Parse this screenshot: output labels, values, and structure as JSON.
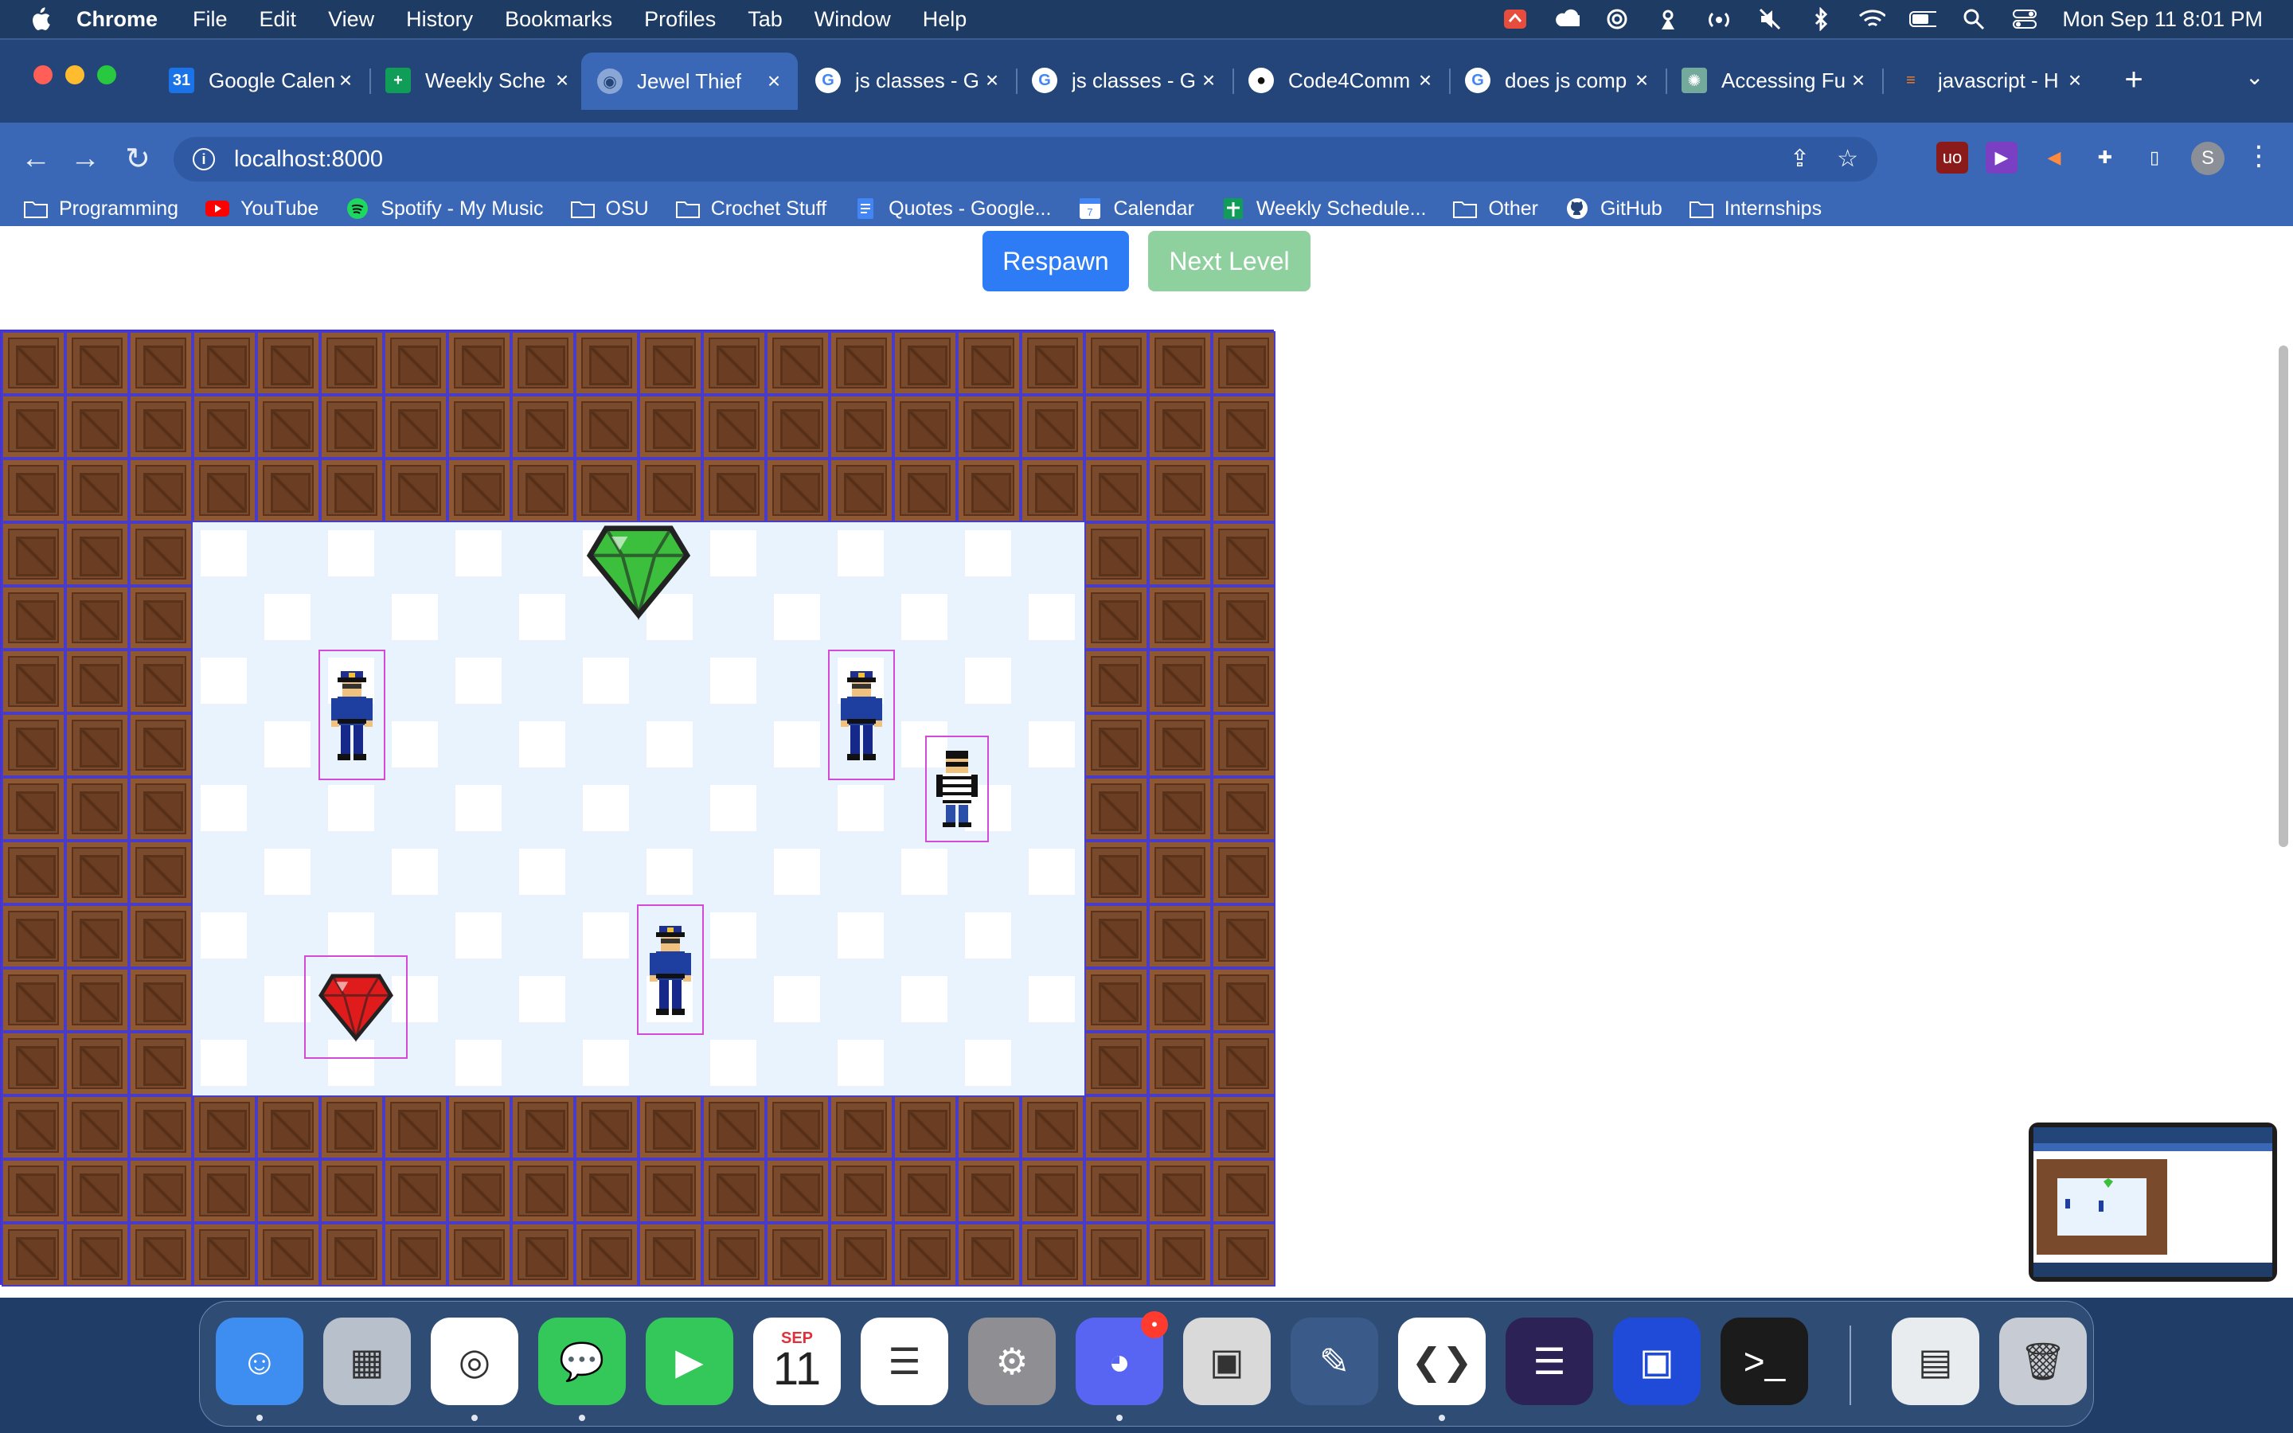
{
  "menubar": {
    "app_name": "Chrome",
    "menus": [
      "File",
      "Edit",
      "View",
      "History",
      "Bookmarks",
      "Profiles",
      "Tab",
      "Window",
      "Help"
    ],
    "status_icons": [
      "app-alert-icon",
      "cloud-icon",
      "moon-icon",
      "airdrop-icon",
      "broadcast-icon",
      "mute-icon",
      "bluetooth-icon",
      "wifi-icon",
      "battery-icon",
      "search-icon",
      "control-center-icon"
    ],
    "clock": "Mon Sep 11  8:01 PM"
  },
  "tabs": [
    {
      "title": "Google Calen",
      "icon": "google-calendar-icon",
      "color": "#1a73e8",
      "glyph": "31"
    },
    {
      "title": "Weekly Sche",
      "icon": "sheets-icon",
      "color": "#0f9d58",
      "glyph": "+"
    },
    {
      "title": "Jewel Thief",
      "icon": "globe-icon",
      "color": "#8aa6d6",
      "glyph": "◉",
      "active": true
    },
    {
      "title": "js classes - G",
      "icon": "google-icon",
      "color": "#ffffff",
      "glyph": "G"
    },
    {
      "title": "js classes - G",
      "icon": "google-icon",
      "color": "#ffffff",
      "glyph": "G"
    },
    {
      "title": "Code4Comm",
      "icon": "github-icon",
      "color": "#ffffff",
      "glyph": "●"
    },
    {
      "title": "does js comp",
      "icon": "google-icon",
      "color": "#ffffff",
      "glyph": "G"
    },
    {
      "title": "Accessing Fu",
      "icon": "chatgpt-icon",
      "color": "#74aa9c",
      "glyph": "✺"
    },
    {
      "title": "javascript - H",
      "icon": "stackoverflow-icon",
      "color": "#f48024",
      "glyph": "≡"
    }
  ],
  "address": {
    "url": "localhost:8000"
  },
  "bookmarks": [
    {
      "label": "Programming",
      "icon": "folder-icon"
    },
    {
      "label": "YouTube",
      "icon": "youtube-icon"
    },
    {
      "label": "Spotify - My Music",
      "icon": "spotify-icon"
    },
    {
      "label": "OSU",
      "icon": "folder-icon"
    },
    {
      "label": "Crochet Stuff",
      "icon": "folder-icon"
    },
    {
      "label": "Quotes - Google...",
      "icon": "docs-icon"
    },
    {
      "label": "Calendar",
      "icon": "calendar-icon"
    },
    {
      "label": "Weekly Schedule...",
      "icon": "sheets-icon"
    },
    {
      "label": "Other",
      "icon": "folder-icon"
    },
    {
      "label": "GitHub",
      "icon": "github-icon"
    },
    {
      "label": "Internships",
      "icon": "folder-icon"
    }
  ],
  "game": {
    "respawn_label": "Respawn",
    "next_level_label": "Next Level",
    "board": {
      "cols": 20,
      "rows": 15,
      "walls": "crate",
      "floor_area": {
        "col_start": 3,
        "col_end": 16,
        "row_start": 3,
        "row_end": 11
      }
    },
    "sprites": [
      {
        "type": "goal-gem",
        "color": "#3cbf3c",
        "col": 9,
        "row": 3
      },
      {
        "type": "guard",
        "col": 5,
        "row": 5
      },
      {
        "type": "guard",
        "col": 13,
        "row": 5
      },
      {
        "type": "thief",
        "col": 15,
        "row": 6
      },
      {
        "type": "guard",
        "col": 10,
        "row": 9
      },
      {
        "type": "ruby",
        "color": "#e01b1b",
        "col": 5,
        "row": 10
      }
    ]
  },
  "dock": {
    "apps": [
      {
        "name": "Finder",
        "icon": "finder-icon",
        "color": "#3d8ef0",
        "glyph": "☺",
        "running": true
      },
      {
        "name": "Launchpad",
        "icon": "launchpad-icon",
        "color": "#b8c0cc",
        "glyph": "▦",
        "running": false
      },
      {
        "name": "Chrome",
        "icon": "chrome-icon",
        "color": "#ffffff",
        "glyph": "◎",
        "running": true
      },
      {
        "name": "Messages",
        "icon": "messages-icon",
        "color": "#34c759",
        "glyph": "💬",
        "running": true
      },
      {
        "name": "FaceTime",
        "icon": "facetime-icon",
        "color": "#34c759",
        "glyph": "▶",
        "running": false
      },
      {
        "name": "Calendar",
        "icon": "calendar-icon",
        "color": "#ffffff",
        "glyph": "11",
        "month": "SEP",
        "running": false
      },
      {
        "name": "Reminders",
        "icon": "reminders-icon",
        "color": "#ffffff",
        "glyph": "☰",
        "running": false
      },
      {
        "name": "System Settings",
        "icon": "settings-icon",
        "color": "#8e8e93",
        "glyph": "⚙",
        "running": false
      },
      {
        "name": "Discord",
        "icon": "discord-icon",
        "color": "#5865f2",
        "glyph": "◕",
        "running": true,
        "badge": "•"
      },
      {
        "name": "Minecraft",
        "icon": "minecraft-icon",
        "color": "#d9d9d9",
        "glyph": "▣",
        "running": false
      },
      {
        "name": "GIMP",
        "icon": "gimp-icon",
        "color": "#3a5a8a",
        "glyph": "✎",
        "running": false
      },
      {
        "name": "VS Code",
        "icon": "vscode-icon",
        "color": "#ffffff",
        "glyph": "❮❯",
        "running": true
      },
      {
        "name": "Eclipse",
        "icon": "eclipse-icon",
        "color": "#2c2255",
        "glyph": "☰",
        "running": false
      },
      {
        "name": "Screen Recorder",
        "icon": "recorder-icon",
        "color": "#1f4bd8",
        "glyph": "▣",
        "running": false
      },
      {
        "name": "Terminal",
        "icon": "terminal-icon",
        "color": "#1b1b1b",
        "glyph": ">_",
        "running": false
      },
      {
        "name": "Downloads",
        "icon": "downloads-stack-icon",
        "color": "#e9ecef",
        "glyph": "▤",
        "running": false
      },
      {
        "name": "Trash",
        "icon": "trash-icon",
        "color": "#c7ccd4",
        "glyph": "🗑",
        "running": false
      }
    ]
  },
  "colors": {
    "respawn": "#2d7cf6",
    "next_level": "#8fd19e",
    "crate": "#7a4a2c",
    "floor": "#e9f3fd",
    "grid_line": "#4434c9",
    "highlight_box": "#d24ad8"
  }
}
